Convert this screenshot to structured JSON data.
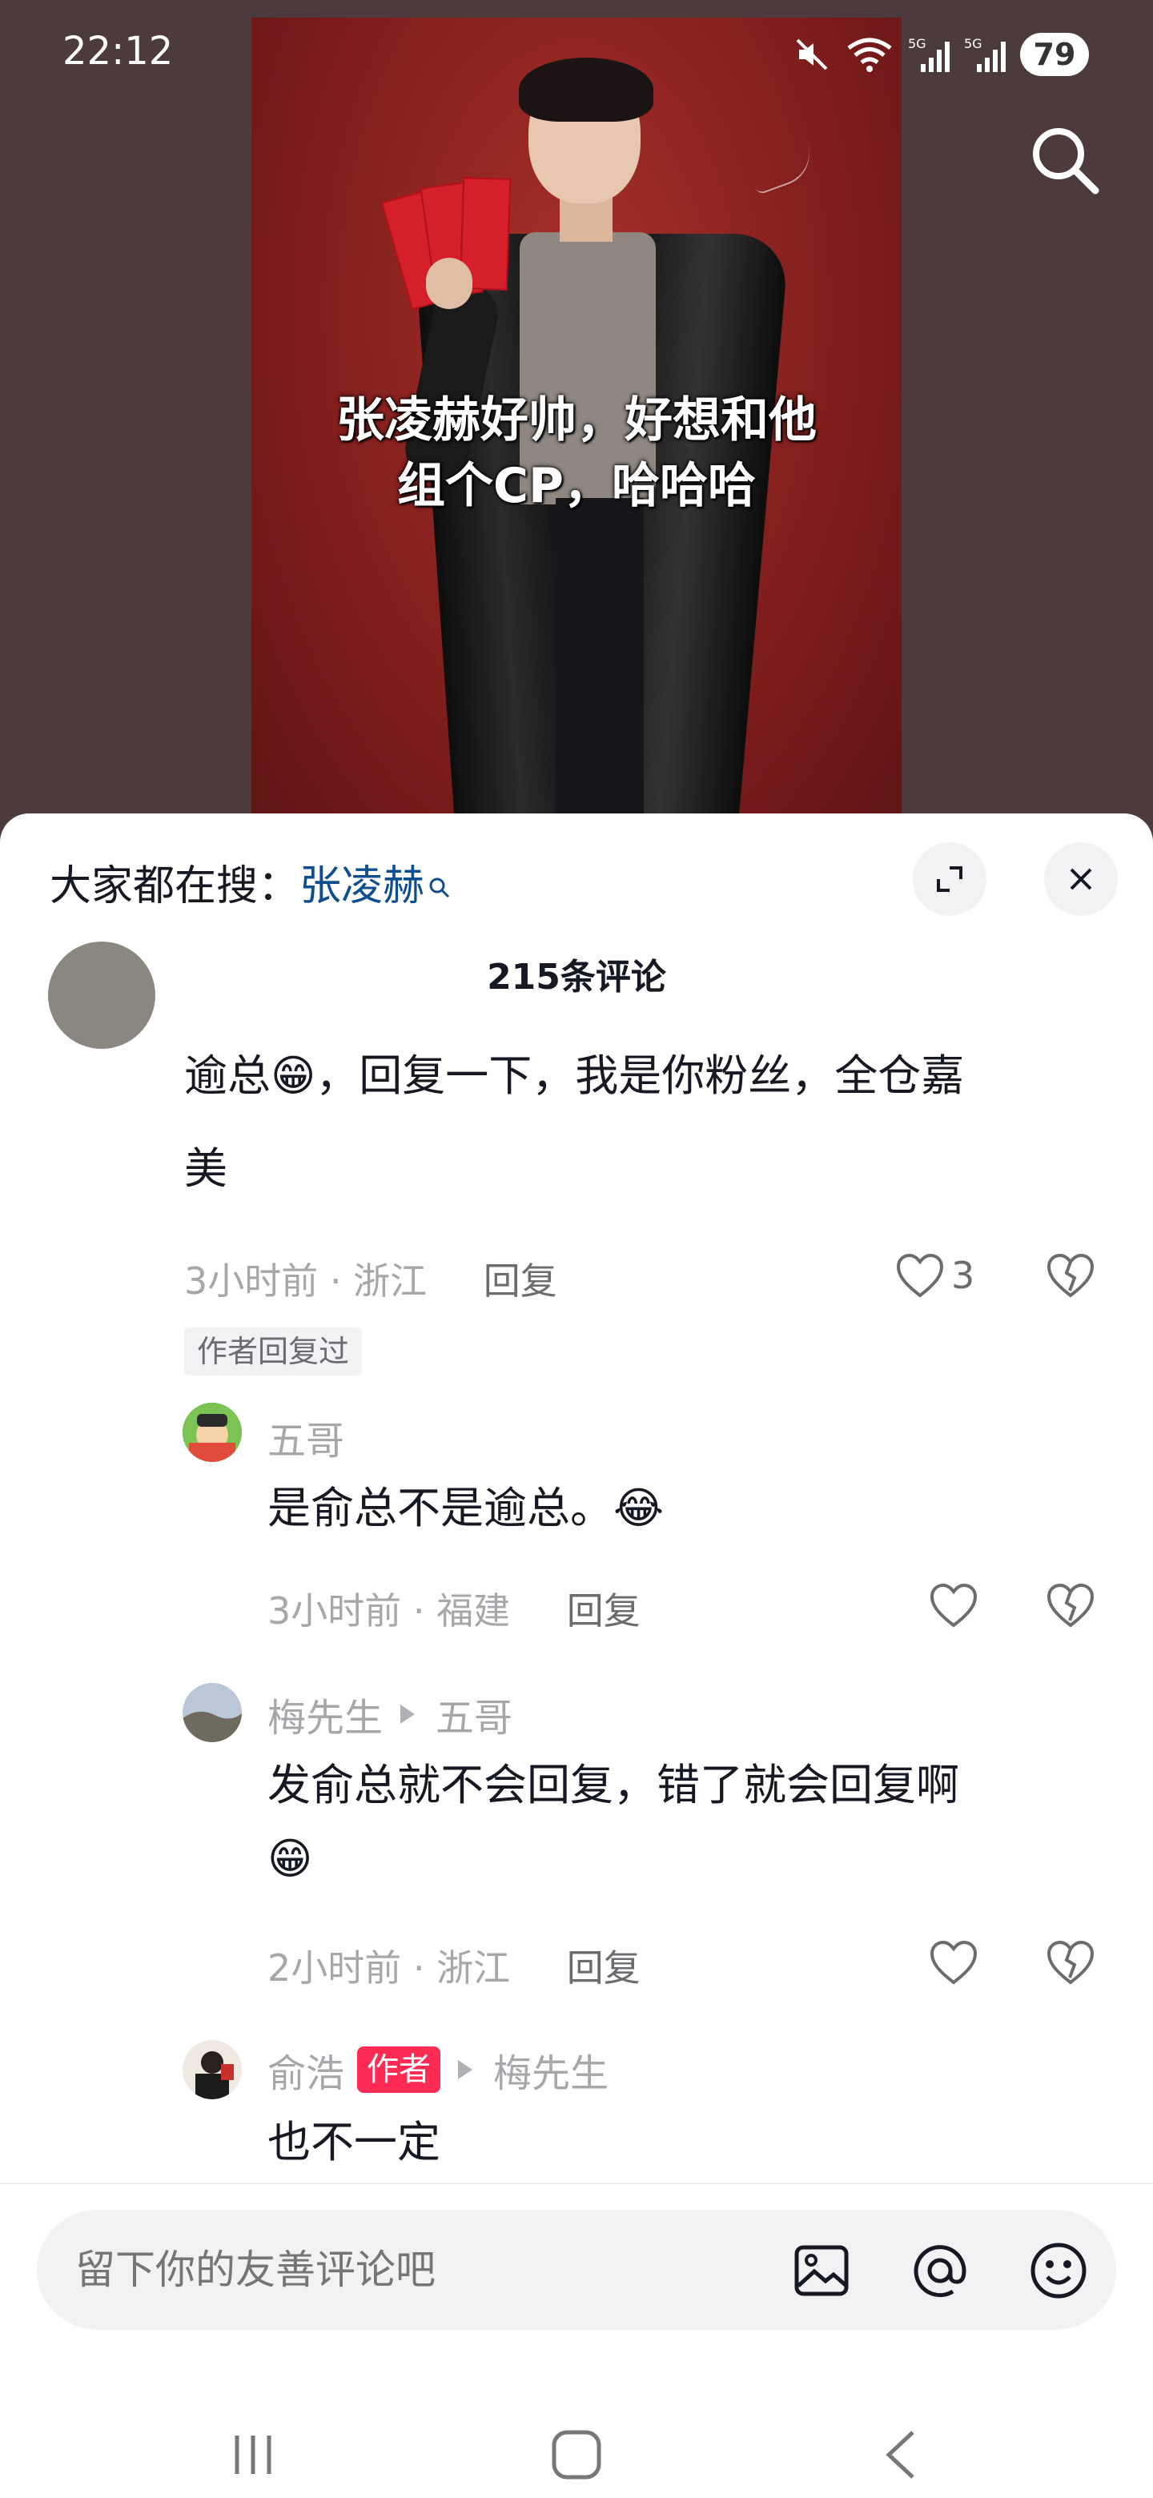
{
  "status_bar": {
    "time": "22:12",
    "battery": "79",
    "net1": "5G",
    "net2": "5G"
  },
  "video": {
    "caption_line1": "张凌赫好帅，好想和他",
    "caption_line2": "组个CP，哈哈哈"
  },
  "panel": {
    "hot_search_label": "大家都在搜：",
    "hot_search_keyword": "张凌赫",
    "comment_count": "215条评论"
  },
  "comments": {
    "main": {
      "text_line1": "逾总😁，回复一下，我是你粉丝，全仓嘉",
      "text_line2": "美",
      "time_location": "3小时前 · 浙江",
      "reply_label": "回复",
      "likes": "3",
      "author_replied_tag": "作者回复过"
    },
    "replies": [
      {
        "name": "五哥",
        "text": "是俞总不是逾总。",
        "emoji": "😂",
        "time_location": "3小时前 · 福建",
        "reply_label": "回复"
      },
      {
        "name": "梅先生",
        "reply_to": "五哥",
        "text": "发俞总就不会回复，错了就会回复啊",
        "emoji": "😁",
        "time_location": "2小时前 · 浙江",
        "reply_label": "回复"
      },
      {
        "name": "俞浩",
        "author_tag": "作者",
        "reply_to": "梅先生",
        "text": "也不一定"
      }
    ]
  },
  "input": {
    "placeholder": "留下你的友善评论吧"
  },
  "colors": {
    "accent_pink": "#fe2c55",
    "keyword_blue": "#0e4e8e",
    "text": "#161823",
    "muted": "#a6a7ab"
  }
}
